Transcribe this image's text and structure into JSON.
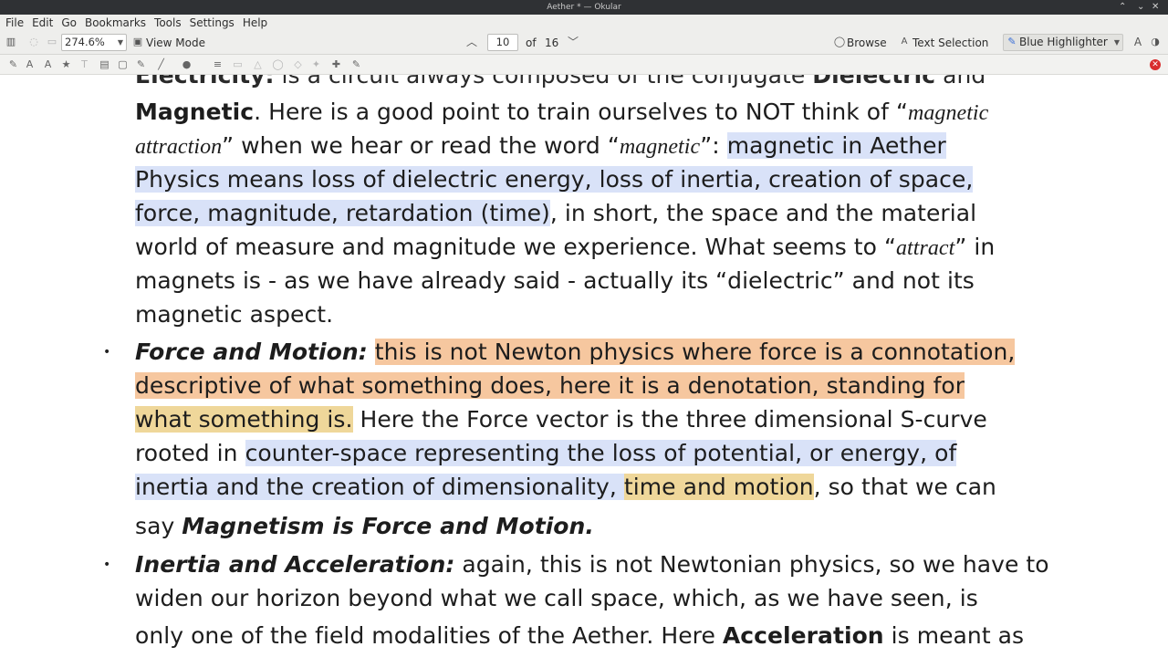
{
  "window": {
    "title": "Aether * — Okular",
    "controls": {
      "minimize": "⌃",
      "maximize": "⌄",
      "close": "✕"
    }
  },
  "menubar": {
    "items": [
      "File",
      "Edit",
      "Go",
      "Bookmarks",
      "Tools",
      "Settings",
      "Help"
    ]
  },
  "toolbar": {
    "zoom": "274.6%",
    "view_mode": "View Mode",
    "page_current": "10",
    "page_of": "of",
    "page_total": "16",
    "browse": "Browse",
    "text_selection": "Text Selection",
    "highlighter": "Blue Highlighter"
  },
  "icons": {
    "sidebar": "sidebar-toggle-icon",
    "prev_page": "chevron-up-icon",
    "next_page": "chevron-down-icon",
    "browse": "hand-icon",
    "text_selection": "text-cursor-icon",
    "highlighter": "highlighter-icon",
    "close_annotations": "close-icon"
  },
  "colors": {
    "blue_highlight": "#d9e2f8",
    "orange_highlight": "#f6c79f",
    "yellow_highlight": "#efd79a",
    "close_button": "#d92d2d"
  },
  "document": {
    "bullet": "•",
    "l0a": "Electricity:",
    "l0b": " is a circuit always composed of the conjugate ",
    "l0c": "Dielectric",
    "l0d": " and",
    "l1a": "Magnetic",
    "l1b": ". Here is a good point to train ourselves to NOT think of “",
    "l1c": "magnetic",
    "l2a": "attraction",
    "l2b": "” when we hear or read the word “",
    "l2c": "magnetic",
    "l2d": "”: ",
    "l2e": "magnetic in Aether",
    "l3a": "Physics means loss of dielectric energy, loss of inertia, creation of space,",
    "l4a": "force, magnitude, retardation (time)",
    "l4b": ", in short, the space and the material",
    "l5a": "world of measure and magnitude we experience. What seems to “",
    "l5b": "attract",
    "l5c": "” in",
    "l6a": "magnets is - as we have already said - actually its “dielectric” and not its",
    "l7a": "magnetic aspect.",
    "l8a": "Force and Motion:",
    "l8b": " ",
    "l8c": "this is not Newton physics where force is a connotation,",
    "l9a": "descriptive of what something does, here it is a denotation, standing for",
    "l10a": "what something is.",
    "l10b": " Here the Force vector is the three dimensional S-curve",
    "l11a": "rooted in ",
    "l11b": "counter-space representing the loss of potential, or energy, of",
    "l12a": "inertia and the creation of dimensionality, ",
    "l12b": "time and motion",
    "l12c": ", so that we can",
    "l13a": "say ",
    "l13b": "Magnetism is Force and Motion.",
    "l14a": "Inertia and Acceleration:",
    "l14b": " again, this is not Newtonian physics, so we have to",
    "l15a": "widen our horizon beyond what we call space, which, as we have seen, is",
    "l16a": "only one of the field modalities of the Aether. Here ",
    "l16b": "Acceleration",
    "l16c": " is meant as"
  }
}
